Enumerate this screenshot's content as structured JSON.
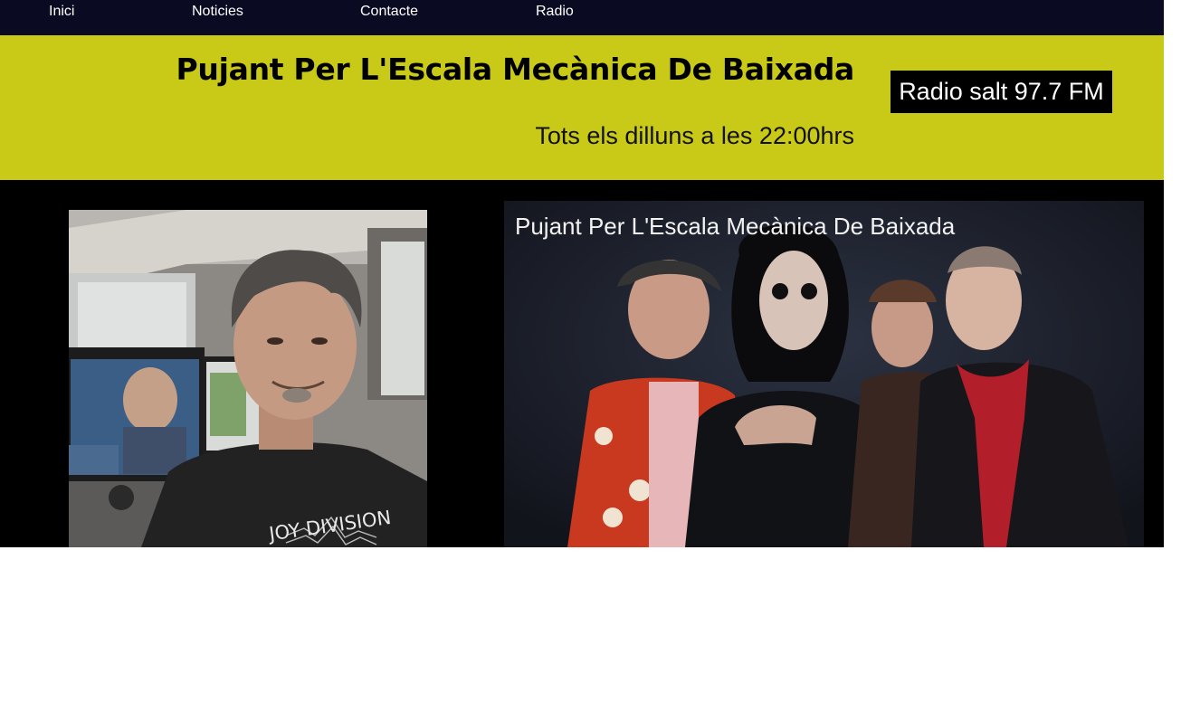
{
  "nav": {
    "items": [
      {
        "label": "Inici"
      },
      {
        "label": "Noticies"
      },
      {
        "label": "Contacte"
      },
      {
        "label": "Radio"
      }
    ]
  },
  "header": {
    "title": "Pujant Per L'Escala Mecànica De Baixada",
    "subtitle": "Tots els dilluns a les 22:00hrs",
    "radio_badge": "Radio salt 97.7 FM"
  },
  "photos": {
    "left": {
      "shirt_text": "JOY DIVISION"
    },
    "right": {
      "caption": "Pujant Per L'Escala Mecànica De Baixada"
    }
  },
  "colors": {
    "nav_bg": "#0a0a22",
    "header_bg": "#c9c918",
    "page_bg": "#000000",
    "badge_bg": "#000000"
  }
}
